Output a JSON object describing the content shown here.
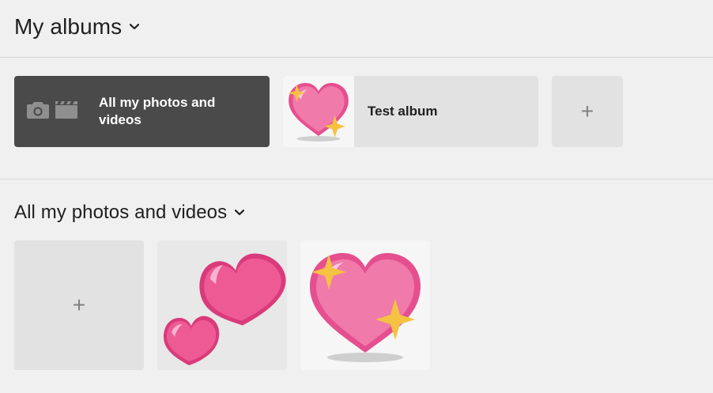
{
  "albums_section": {
    "title": "My albums",
    "chevron_icon": "chevron-down-icon"
  },
  "albums": [
    {
      "label": "All my photos and videos",
      "icons": [
        "camera-icon",
        "film-clapper-icon"
      ],
      "background": "#4a4a4a"
    },
    {
      "label": "Test album",
      "thumbnail": "sparkling-heart-icon",
      "background": "#e2e2e2"
    }
  ],
  "add_album": {
    "label": "+"
  },
  "photos_section": {
    "title": "All my photos and videos",
    "chevron_icon": "chevron-down-icon"
  },
  "add_photo": {
    "label": "+"
  },
  "photos": [
    {
      "icon": "two-hearts-icon"
    },
    {
      "icon": "sparkling-heart-icon"
    }
  ],
  "colors": {
    "background": "#f0f0f0",
    "divider": "#d8d8d8",
    "tile": "#e2e2e2",
    "heart_pink": "#ee5a94",
    "sparkle_gold": "#f5c242"
  }
}
